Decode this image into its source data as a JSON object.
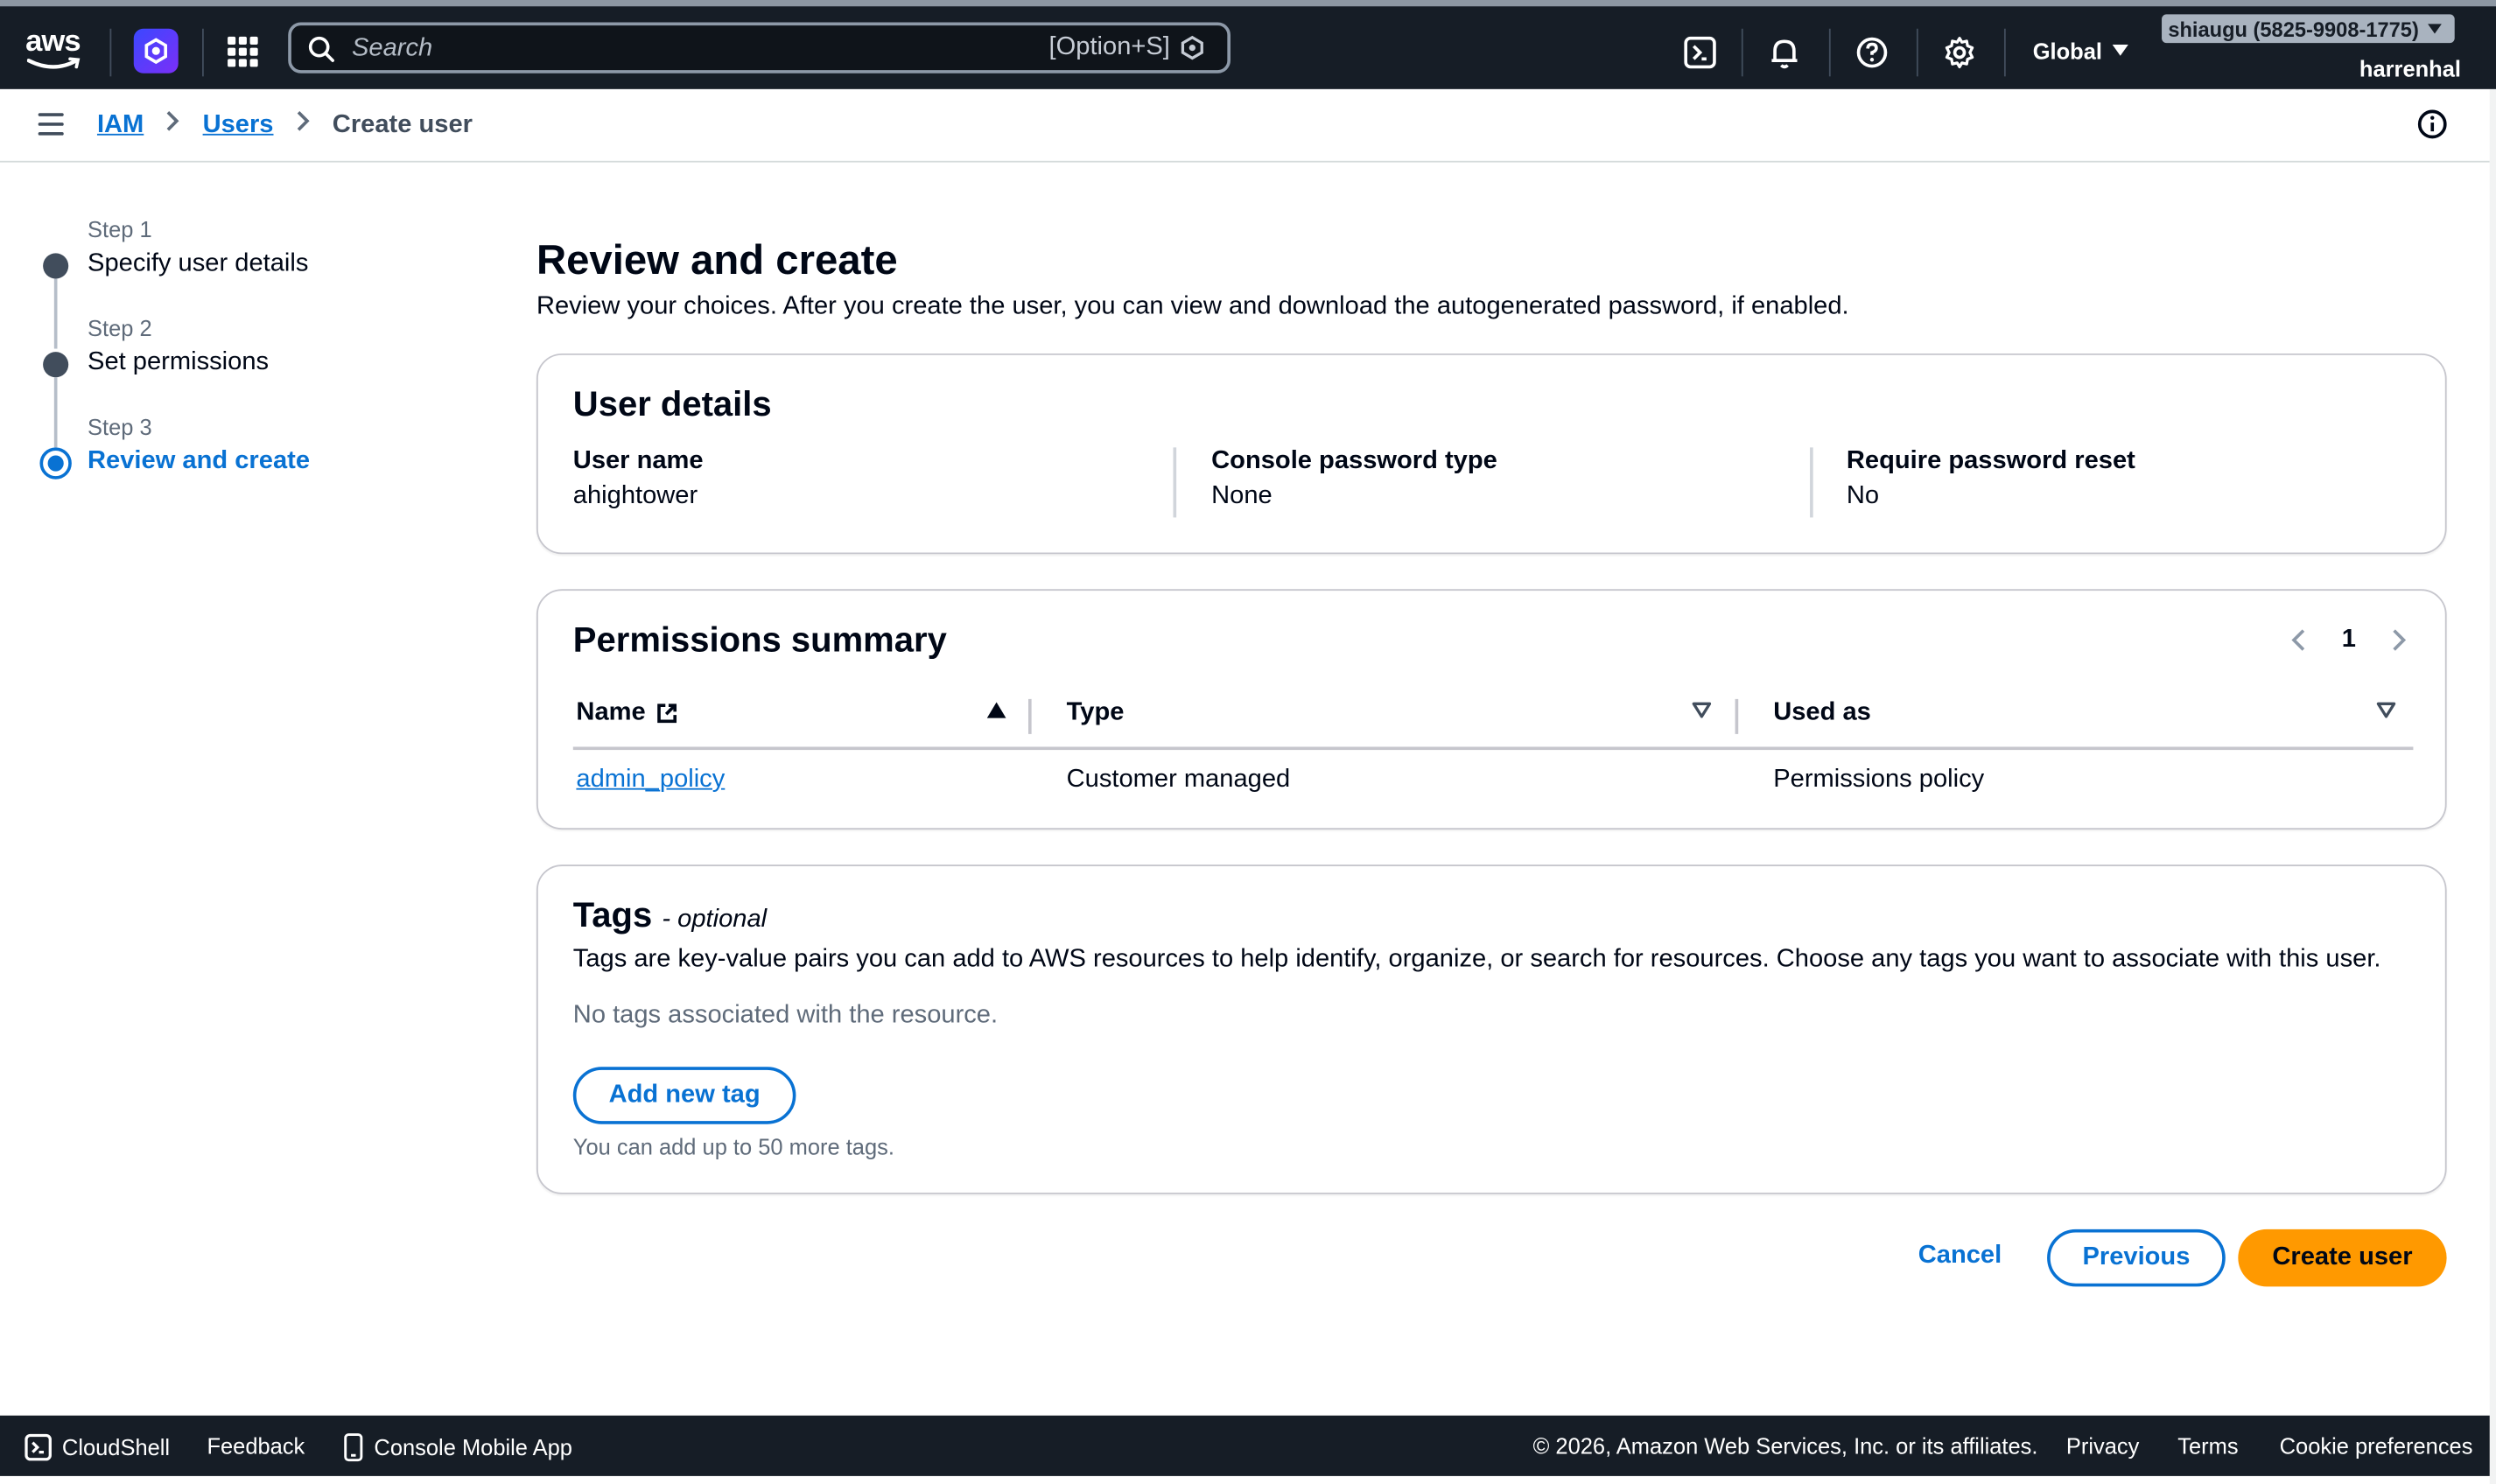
{
  "topnav": {
    "logo_text": "aws",
    "search_placeholder": "Search",
    "search_shortcut": "[Option+S]",
    "region": "Global",
    "account": "shiaugu (5825-9908-1775)",
    "user": "harrenhal",
    "icons": [
      "cloudshell-icon",
      "bell-icon",
      "help-icon",
      "gear-icon"
    ]
  },
  "breadcrumb": {
    "items": [
      "IAM",
      "Users"
    ],
    "current": "Create user"
  },
  "steps": [
    {
      "label": "Step 1",
      "name": "Specify user details"
    },
    {
      "label": "Step 2",
      "name": "Set permissions"
    },
    {
      "label": "Step 3",
      "name": "Review and create"
    }
  ],
  "page": {
    "title": "Review and create",
    "description": "Review your choices. After you create the user, you can view and download the autogenerated password, if enabled."
  },
  "user_details": {
    "heading": "User details",
    "fields": [
      {
        "key": "User name",
        "value": "ahightower"
      },
      {
        "key": "Console password type",
        "value": "None"
      },
      {
        "key": "Require password reset",
        "value": "No"
      }
    ]
  },
  "permissions": {
    "heading": "Permissions summary",
    "page": "1",
    "columns": [
      "Name",
      "Type",
      "Used as"
    ],
    "rows": [
      {
        "name": "admin_policy",
        "type": "Customer managed",
        "used_as": "Permissions policy"
      }
    ]
  },
  "tags": {
    "heading": "Tags",
    "optional": "- optional",
    "description": "Tags are key-value pairs you can add to AWS resources to help identify, organize, or search for resources. Choose any tags you want to associate with this user.",
    "empty": "No tags associated with the resource.",
    "add_button": "Add new tag",
    "hint": "You can add up to 50 more tags."
  },
  "actions": {
    "cancel": "Cancel",
    "previous": "Previous",
    "create": "Create user"
  },
  "footer": {
    "cloudshell": "CloudShell",
    "feedback": "Feedback",
    "mobile": "Console Mobile App",
    "copyright": "© 2026, Amazon Web Services, Inc. or its affiliates.",
    "privacy": "Privacy",
    "terms": "Terms",
    "cookies": "Cookie preferences"
  },
  "colors": {
    "nav_bg": "#161d26",
    "link": "#0972d3",
    "primary_button": "#ff9900"
  }
}
